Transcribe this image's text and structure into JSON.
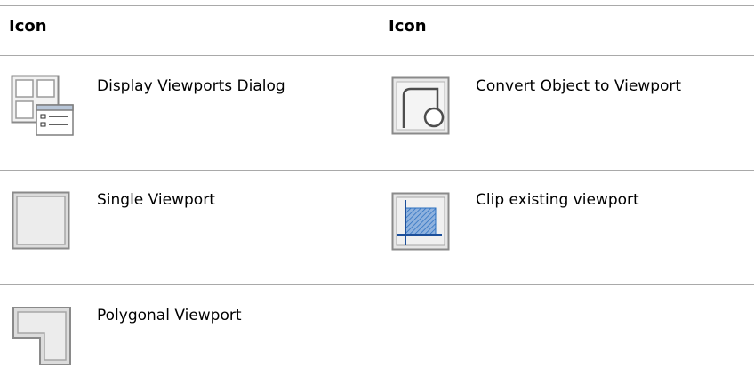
{
  "table": {
    "headers": [
      "Icon",
      "Icon"
    ],
    "rows": [
      {
        "left": {
          "icon": "display-viewports-dialog-icon",
          "label": "Display Viewports Dialog"
        },
        "right": {
          "icon": "convert-object-to-viewport-icon",
          "label": "Convert Object to Viewport"
        }
      },
      {
        "left": {
          "icon": "single-viewport-icon",
          "label": "Single Viewport"
        },
        "right": {
          "icon": "clip-existing-viewport-icon",
          "label": "Clip existing viewport"
        }
      },
      {
        "left": {
          "icon": "polygonal-viewport-icon",
          "label": "Polygonal Viewport"
        }
      }
    ]
  },
  "colors": {
    "rule": "#a9a9a9",
    "icon_frame": "#8a8a8a",
    "icon_fill": "#e6e6e6",
    "clip_blue": "#2a6fc0"
  }
}
